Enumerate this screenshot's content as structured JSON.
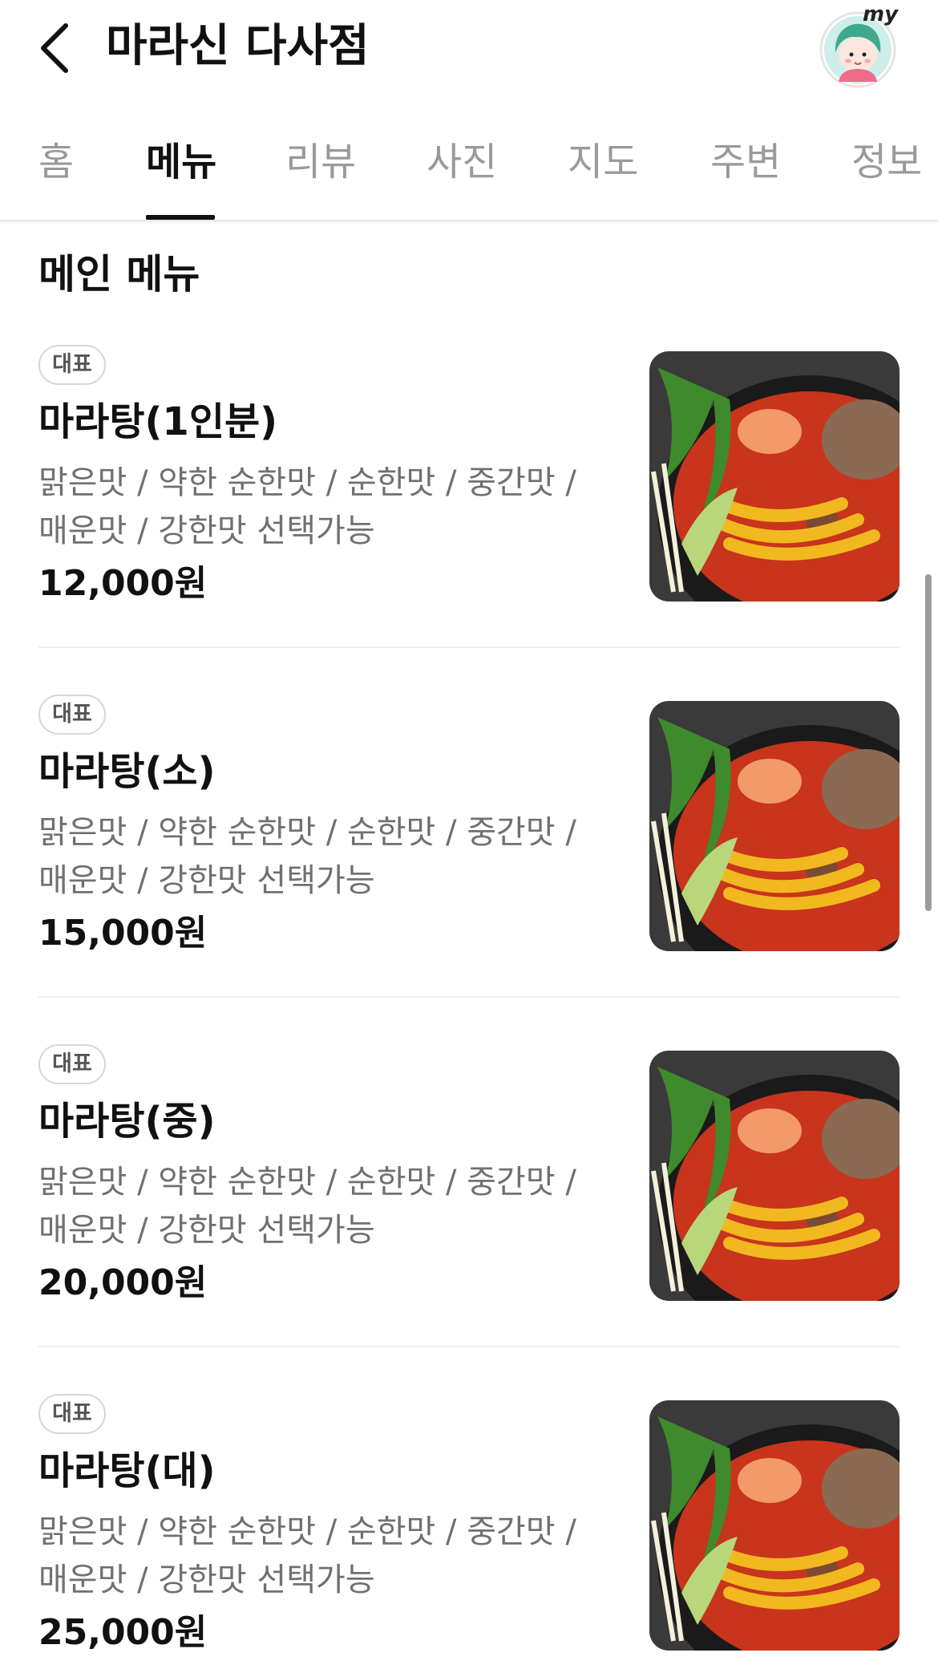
{
  "header": {
    "title": "마라신 다사점",
    "my_label": "my"
  },
  "tabs": [
    {
      "label": "홈",
      "active": false
    },
    {
      "label": "메뉴",
      "active": true
    },
    {
      "label": "리뷰",
      "active": false
    },
    {
      "label": "사진",
      "active": false
    },
    {
      "label": "지도",
      "active": false
    },
    {
      "label": "주변",
      "active": false
    },
    {
      "label": "정보",
      "active": false
    }
  ],
  "menu_section": {
    "title": "메인 메뉴",
    "items": [
      {
        "badge": "대표",
        "name": "마라탕(1인분)",
        "desc_line1": "맑은맛 / 약한 순한맛 / 순한맛 / 중간맛 /",
        "desc_line2": "매운맛 / 강한맛 선택가능",
        "price": "12,000원"
      },
      {
        "badge": "대표",
        "name": "마라탕(소)",
        "desc_line1": "맑은맛 / 약한 순한맛 / 순한맛 / 중간맛 /",
        "desc_line2": "매운맛 / 강한맛 선택가능",
        "price": "15,000원"
      },
      {
        "badge": "대표",
        "name": "마라탕(중)",
        "desc_line1": "맑은맛 / 약한 순한맛 / 순한맛 / 중간맛 /",
        "desc_line2": "매운맛 / 강한맛 선택가능",
        "price": "20,000원"
      },
      {
        "badge": "대표",
        "name": "마라탕(대)",
        "desc_line1": "맑은맛 / 약한 순한맛 / 순한맛 / 중간맛 /",
        "desc_line2": "매운맛 / 강한맛 선택가능",
        "price": "25,000원"
      }
    ]
  },
  "colors": {
    "text_primary": "#111111",
    "text_secondary": "#707070",
    "tab_inactive": "#9a9a9a",
    "soup_red": "#c8341c",
    "noodle_yellow": "#f2b820",
    "bowl_black": "#1a1a1a",
    "avatar_bg": "#cdeee9"
  },
  "icons": {
    "back": "chevron-left-icon",
    "profile": "my-avatar-icon"
  }
}
